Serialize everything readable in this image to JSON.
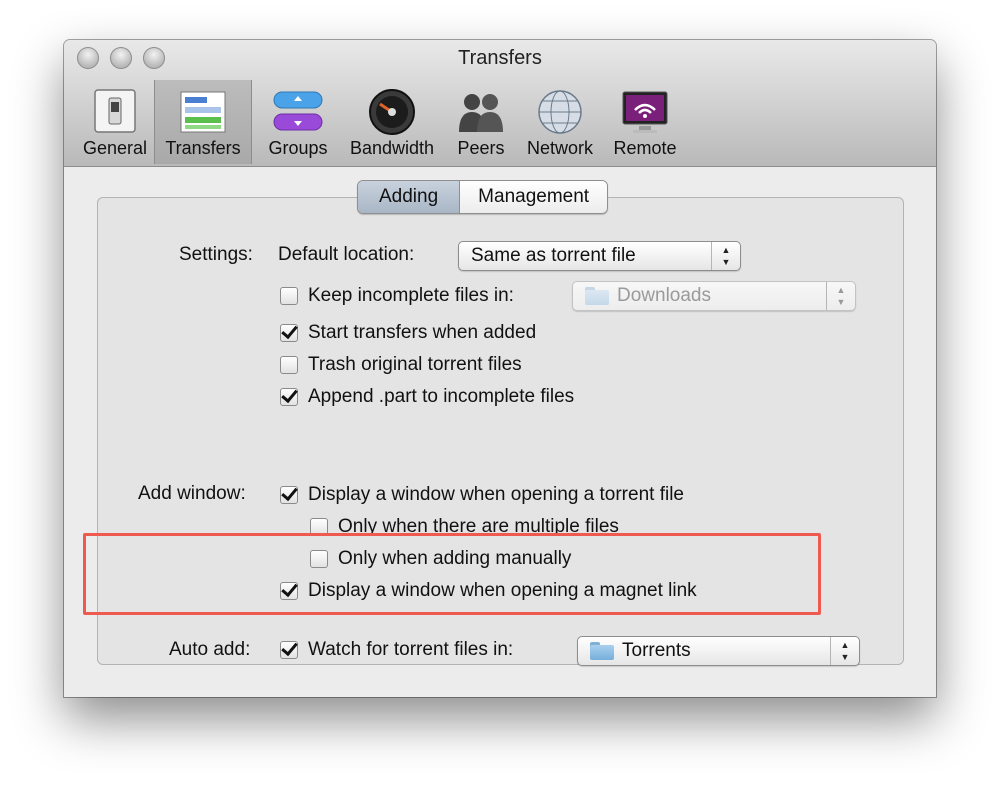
{
  "window": {
    "title": "Transfers"
  },
  "toolbar": {
    "items": [
      {
        "label": "General",
        "icon": "general-switch-icon"
      },
      {
        "label": "Transfers",
        "icon": "transfers-list-icon"
      },
      {
        "label": "Groups",
        "icon": "groups-icon"
      },
      {
        "label": "Bandwidth",
        "icon": "bandwidth-gauge-icon"
      },
      {
        "label": "Peers",
        "icon": "peers-people-icon"
      },
      {
        "label": "Network",
        "icon": "network-globe-icon"
      },
      {
        "label": "Remote",
        "icon": "remote-monitor-icon"
      }
    ],
    "selected": "Transfers"
  },
  "tabs": {
    "adding": "Adding",
    "management": "Management",
    "active": "Adding"
  },
  "settings": {
    "label": "Settings:",
    "default_location_label": "Default location:",
    "default_location_value": "Same as torrent file",
    "keep_incomplete": {
      "label": "Keep incomplete files in:",
      "checked": false,
      "folder": "Downloads",
      "enabled": false
    },
    "start_transfers": {
      "label": "Start transfers when added",
      "checked": true
    },
    "trash_original": {
      "label": "Trash original torrent files",
      "checked": false
    },
    "append_part": {
      "label": "Append .part to incomplete files",
      "checked": true
    }
  },
  "add_window": {
    "label": "Add window:",
    "display_window_torrent": {
      "label": "Display a window when opening a torrent file",
      "checked": true
    },
    "only_multiple": {
      "label": "Only when there are multiple files",
      "checked": false
    },
    "only_manual": {
      "label": "Only when adding manually",
      "checked": false
    },
    "display_window_magnet": {
      "label": "Display a window when opening a magnet link",
      "checked": true
    }
  },
  "auto_add": {
    "label": "Auto add:",
    "watch": {
      "label": "Watch for torrent files in:",
      "checked": true,
      "folder": "Torrents"
    }
  },
  "colors": {
    "highlight_border": "#ef5a50",
    "selected_tab": "#a9b6c5"
  }
}
